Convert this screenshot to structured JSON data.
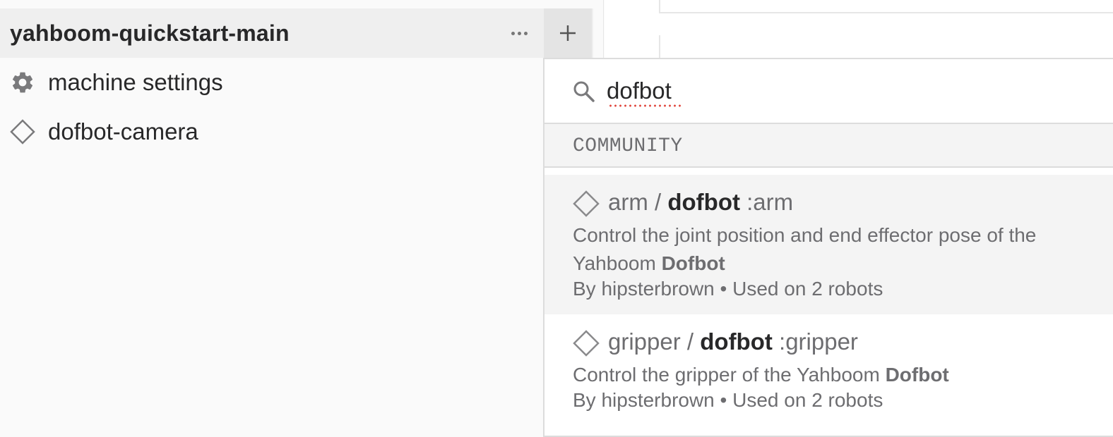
{
  "sidebar": {
    "project_title": "yahboom-quickstart-main",
    "items": [
      {
        "label": "machine settings",
        "icon": "gear-icon"
      },
      {
        "label": "dofbot-camera",
        "icon": "diamond-icon"
      }
    ]
  },
  "dropdown": {
    "search": {
      "value": "dofbot",
      "placeholder": ""
    },
    "section_label": "COMMUNITY",
    "results": [
      {
        "icon": "diamond-icon",
        "type": "arm",
        "separator": "/",
        "model": "dofbot",
        "suffix": ":arm",
        "desc_prefix": "Control the joint position and end effector pose of the Yahboom ",
        "desc_bold": "Dofbot",
        "meta": "By hipsterbrown • Used on 2 robots",
        "highlighted": true
      },
      {
        "icon": "diamond-icon",
        "type": "gripper",
        "separator": "/",
        "model": "dofbot",
        "suffix": ":gripper",
        "desc_prefix": "Control the gripper of the Yahboom ",
        "desc_bold": "Dofbot",
        "meta": "By hipsterbrown • Used on 2 robots",
        "highlighted": false
      }
    ]
  },
  "colors": {
    "text_primary": "#282829",
    "text_secondary": "#6d6d70",
    "header_bg": "#efefef",
    "highlight_bg": "#f4f4f4",
    "spellcheck": "#e0463c"
  }
}
